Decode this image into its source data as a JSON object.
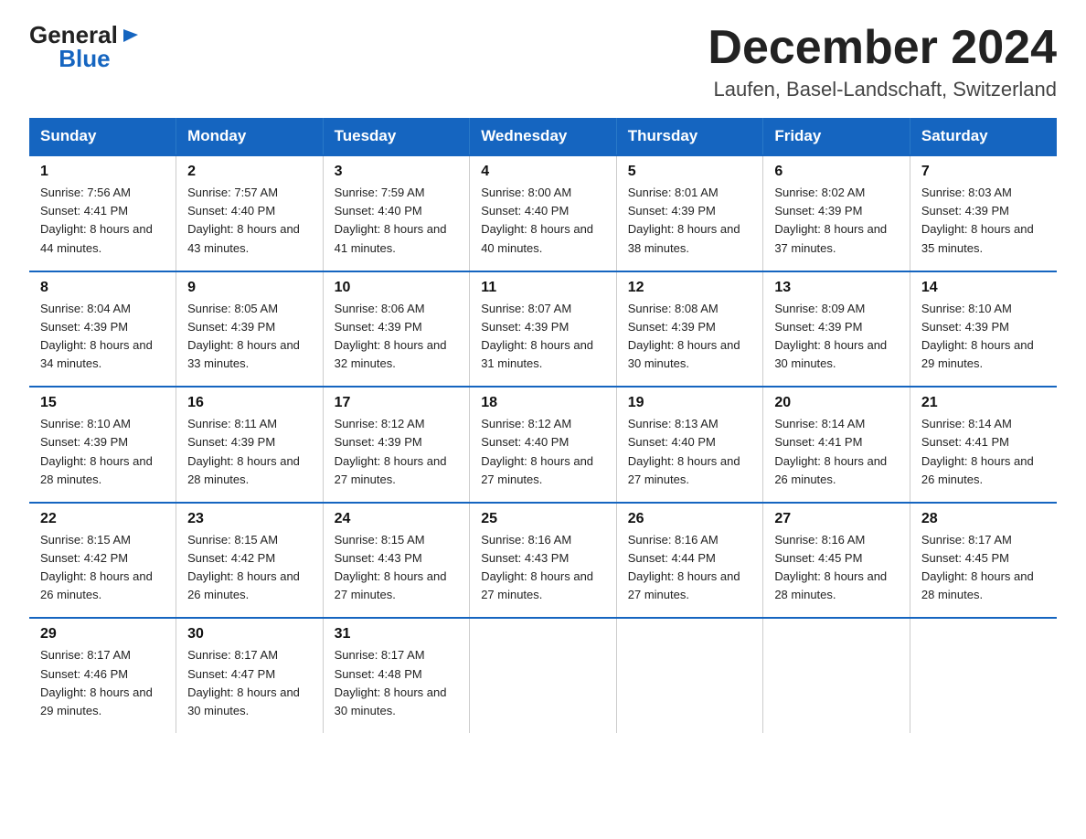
{
  "logo": {
    "general": "General",
    "blue": "Blue",
    "tagline": ""
  },
  "header": {
    "month_year": "December 2024",
    "location": "Laufen, Basel-Landschaft, Switzerland"
  },
  "days_of_week": [
    "Sunday",
    "Monday",
    "Tuesday",
    "Wednesday",
    "Thursday",
    "Friday",
    "Saturday"
  ],
  "weeks": [
    [
      {
        "day": "1",
        "sunrise": "7:56 AM",
        "sunset": "4:41 PM",
        "daylight": "8 hours and 44 minutes."
      },
      {
        "day": "2",
        "sunrise": "7:57 AM",
        "sunset": "4:40 PM",
        "daylight": "8 hours and 43 minutes."
      },
      {
        "day": "3",
        "sunrise": "7:59 AM",
        "sunset": "4:40 PM",
        "daylight": "8 hours and 41 minutes."
      },
      {
        "day": "4",
        "sunrise": "8:00 AM",
        "sunset": "4:40 PM",
        "daylight": "8 hours and 40 minutes."
      },
      {
        "day": "5",
        "sunrise": "8:01 AM",
        "sunset": "4:39 PM",
        "daylight": "8 hours and 38 minutes."
      },
      {
        "day": "6",
        "sunrise": "8:02 AM",
        "sunset": "4:39 PM",
        "daylight": "8 hours and 37 minutes."
      },
      {
        "day": "7",
        "sunrise": "8:03 AM",
        "sunset": "4:39 PM",
        "daylight": "8 hours and 35 minutes."
      }
    ],
    [
      {
        "day": "8",
        "sunrise": "8:04 AM",
        "sunset": "4:39 PM",
        "daylight": "8 hours and 34 minutes."
      },
      {
        "day": "9",
        "sunrise": "8:05 AM",
        "sunset": "4:39 PM",
        "daylight": "8 hours and 33 minutes."
      },
      {
        "day": "10",
        "sunrise": "8:06 AM",
        "sunset": "4:39 PM",
        "daylight": "8 hours and 32 minutes."
      },
      {
        "day": "11",
        "sunrise": "8:07 AM",
        "sunset": "4:39 PM",
        "daylight": "8 hours and 31 minutes."
      },
      {
        "day": "12",
        "sunrise": "8:08 AM",
        "sunset": "4:39 PM",
        "daylight": "8 hours and 30 minutes."
      },
      {
        "day": "13",
        "sunrise": "8:09 AM",
        "sunset": "4:39 PM",
        "daylight": "8 hours and 30 minutes."
      },
      {
        "day": "14",
        "sunrise": "8:10 AM",
        "sunset": "4:39 PM",
        "daylight": "8 hours and 29 minutes."
      }
    ],
    [
      {
        "day": "15",
        "sunrise": "8:10 AM",
        "sunset": "4:39 PM",
        "daylight": "8 hours and 28 minutes."
      },
      {
        "day": "16",
        "sunrise": "8:11 AM",
        "sunset": "4:39 PM",
        "daylight": "8 hours and 28 minutes."
      },
      {
        "day": "17",
        "sunrise": "8:12 AM",
        "sunset": "4:39 PM",
        "daylight": "8 hours and 27 minutes."
      },
      {
        "day": "18",
        "sunrise": "8:12 AM",
        "sunset": "4:40 PM",
        "daylight": "8 hours and 27 minutes."
      },
      {
        "day": "19",
        "sunrise": "8:13 AM",
        "sunset": "4:40 PM",
        "daylight": "8 hours and 27 minutes."
      },
      {
        "day": "20",
        "sunrise": "8:14 AM",
        "sunset": "4:41 PM",
        "daylight": "8 hours and 26 minutes."
      },
      {
        "day": "21",
        "sunrise": "8:14 AM",
        "sunset": "4:41 PM",
        "daylight": "8 hours and 26 minutes."
      }
    ],
    [
      {
        "day": "22",
        "sunrise": "8:15 AM",
        "sunset": "4:42 PM",
        "daylight": "8 hours and 26 minutes."
      },
      {
        "day": "23",
        "sunrise": "8:15 AM",
        "sunset": "4:42 PM",
        "daylight": "8 hours and 26 minutes."
      },
      {
        "day": "24",
        "sunrise": "8:15 AM",
        "sunset": "4:43 PM",
        "daylight": "8 hours and 27 minutes."
      },
      {
        "day": "25",
        "sunrise": "8:16 AM",
        "sunset": "4:43 PM",
        "daylight": "8 hours and 27 minutes."
      },
      {
        "day": "26",
        "sunrise": "8:16 AM",
        "sunset": "4:44 PM",
        "daylight": "8 hours and 27 minutes."
      },
      {
        "day": "27",
        "sunrise": "8:16 AM",
        "sunset": "4:45 PM",
        "daylight": "8 hours and 28 minutes."
      },
      {
        "day": "28",
        "sunrise": "8:17 AM",
        "sunset": "4:45 PM",
        "daylight": "8 hours and 28 minutes."
      }
    ],
    [
      {
        "day": "29",
        "sunrise": "8:17 AM",
        "sunset": "4:46 PM",
        "daylight": "8 hours and 29 minutes."
      },
      {
        "day": "30",
        "sunrise": "8:17 AM",
        "sunset": "4:47 PM",
        "daylight": "8 hours and 30 minutes."
      },
      {
        "day": "31",
        "sunrise": "8:17 AM",
        "sunset": "4:48 PM",
        "daylight": "8 hours and 30 minutes."
      },
      null,
      null,
      null,
      null
    ]
  ]
}
